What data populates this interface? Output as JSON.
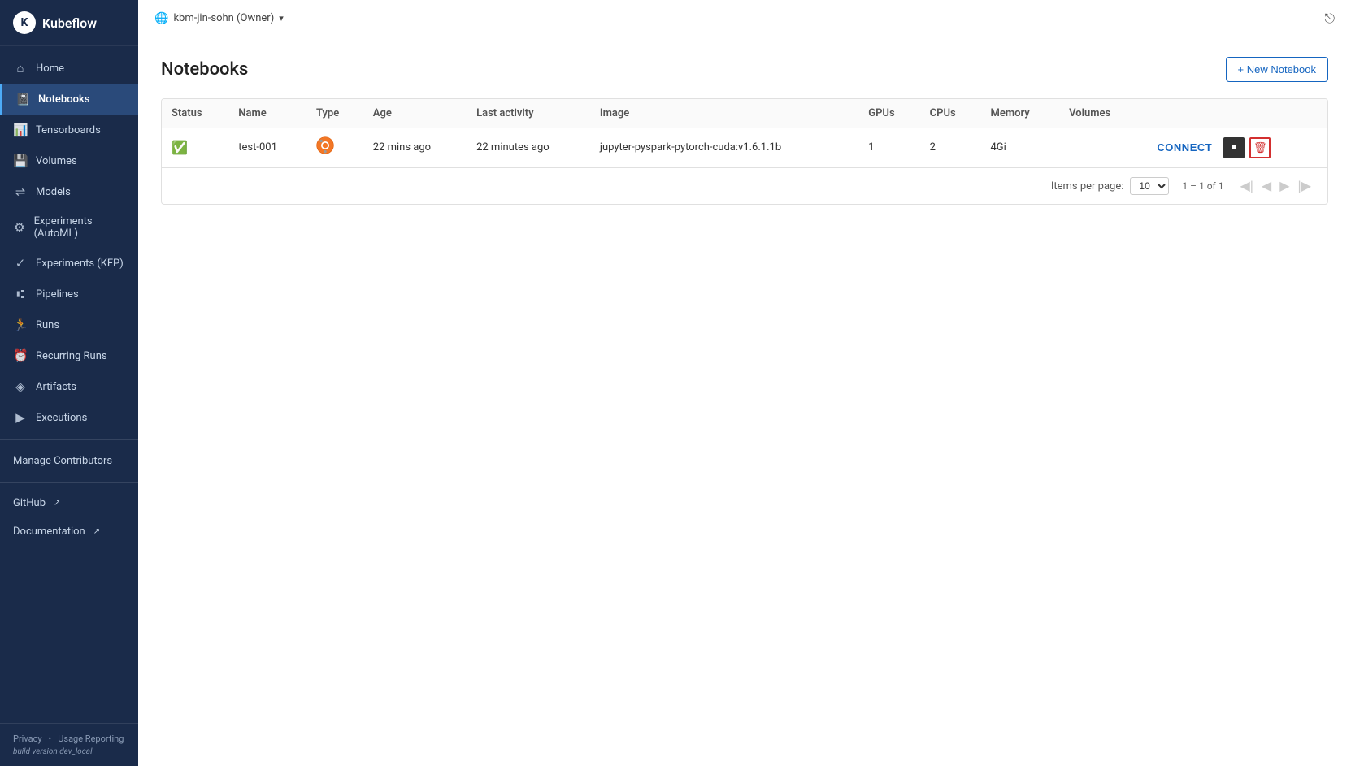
{
  "app": {
    "title": "Kubeflow"
  },
  "topbar": {
    "namespace_icon": "🌐",
    "namespace_label": "kbm-jin-sohn (Owner)",
    "dropdown_icon": "▾",
    "exit_icon": "⎋"
  },
  "sidebar": {
    "logo_text": "Kubeflow",
    "items": [
      {
        "id": "home",
        "label": "Home",
        "icon": "⌂"
      },
      {
        "id": "notebooks",
        "label": "Notebooks",
        "icon": "📓",
        "active": true
      },
      {
        "id": "tensorboards",
        "label": "Tensorboards",
        "icon": "📊"
      },
      {
        "id": "volumes",
        "label": "Volumes",
        "icon": "💾"
      },
      {
        "id": "models",
        "label": "Models",
        "icon": "⇌"
      },
      {
        "id": "experiments-automl",
        "label": "Experiments (AutoML)",
        "icon": "⚙"
      },
      {
        "id": "experiments-kfp",
        "label": "Experiments (KFP)",
        "icon": "✓"
      },
      {
        "id": "pipelines",
        "label": "Pipelines",
        "icon": "⑆"
      },
      {
        "id": "runs",
        "label": "Runs",
        "icon": "🏃"
      },
      {
        "id": "recurring-runs",
        "label": "Recurring Runs",
        "icon": "⏰"
      },
      {
        "id": "artifacts",
        "label": "Artifacts",
        "icon": "◈"
      },
      {
        "id": "executions",
        "label": "Executions",
        "icon": "▶"
      }
    ],
    "manage_contributors": "Manage Contributors",
    "github_label": "GitHub",
    "documentation_label": "Documentation",
    "footer": {
      "privacy": "Privacy",
      "usage_reporting": "Usage Reporting",
      "build_version": "build version dev_local"
    }
  },
  "page": {
    "title": "Notebooks",
    "new_button_label": "+ New Notebook"
  },
  "table": {
    "columns": [
      "Status",
      "Name",
      "Type",
      "Age",
      "Last activity",
      "Image",
      "GPUs",
      "CPUs",
      "Memory",
      "Volumes"
    ],
    "rows": [
      {
        "status": "✓",
        "name": "test-001",
        "type_icon": "jupyter",
        "age": "22 mins ago",
        "last_activity": "22 minutes ago",
        "image": "jupyter-pyspark-pytorch-cuda:v1.6.1.1b",
        "gpus": "1",
        "cpus": "2",
        "memory": "4Gi",
        "volumes": ""
      }
    ],
    "connect_label": "CONNECT",
    "more_icon": "⋮",
    "stop_icon": "■",
    "delete_icon": "🗑"
  },
  "pagination": {
    "items_per_page_label": "Items per page:",
    "per_page_value": "10",
    "page_info": "1 – 1 of 1",
    "first_icon": "◀◀",
    "prev_icon": "◀",
    "next_icon": "▶",
    "last_icon": "▶▶"
  }
}
